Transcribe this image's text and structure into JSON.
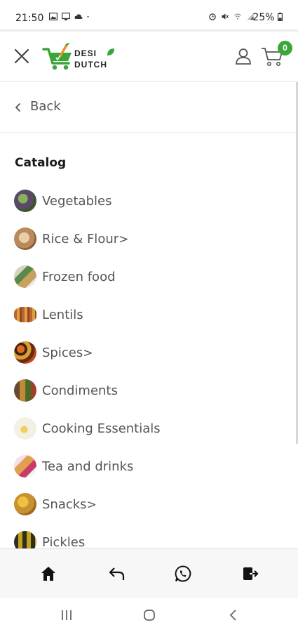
{
  "status_bar": {
    "time": "21:50",
    "battery": "25%",
    "icons": [
      "gallery-icon",
      "cast-icon",
      "cloud-icon",
      "dot-icon",
      "alarm-icon",
      "mute-icon",
      "wifi-icon",
      "signal-icon",
      "battery-icon"
    ]
  },
  "header": {
    "logo_line1": "DESI",
    "logo_line2": "DUTCH",
    "cart_count": "0",
    "brand_color": "#3aa63a",
    "accent_color": "#f0902a"
  },
  "back": {
    "label": "Back"
  },
  "catalog": {
    "title": "Catalog",
    "items": [
      {
        "label": "Vegetables",
        "caret": "",
        "icon": "vegetables-thumb-icon"
      },
      {
        "label": "Rice & Flour",
        "caret": ">",
        "icon": "rice-flour-thumb-icon"
      },
      {
        "label": "Frozen food",
        "caret": "",
        "icon": "frozen-food-thumb-icon"
      },
      {
        "label": "Lentils",
        "caret": "",
        "icon": "lentils-thumb-icon"
      },
      {
        "label": "Spices",
        "caret": ">",
        "icon": "spices-thumb-icon"
      },
      {
        "label": "Condiments",
        "caret": "",
        "icon": "condiments-thumb-icon"
      },
      {
        "label": "Cooking Essentials",
        "caret": "",
        "icon": "cooking-essentials-thumb-icon"
      },
      {
        "label": "Tea and drinks",
        "caret": "",
        "icon": "tea-drinks-thumb-icon"
      },
      {
        "label": "Snacks",
        "caret": ">",
        "icon": "snacks-thumb-icon"
      },
      {
        "label": "Pickles",
        "caret": "",
        "icon": "pickles-thumb-icon"
      }
    ]
  },
  "bottom_nav": {
    "icons": [
      "home-icon",
      "back-arrow-icon",
      "whatsapp-icon",
      "logout-icon"
    ]
  },
  "system_nav": {
    "icons": [
      "recents-icon",
      "home-circle-icon",
      "system-back-icon"
    ]
  }
}
